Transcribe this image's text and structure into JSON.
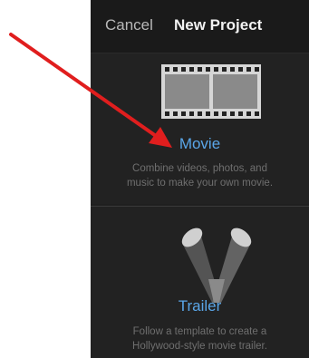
{
  "nav": {
    "cancel_label": "Cancel",
    "title": "New Project"
  },
  "options": [
    {
      "label": "Movie",
      "description_line1": "Combine videos, photos, and",
      "description_line2": "music to make your own movie.",
      "icon": "film-strip-icon"
    },
    {
      "label": "Trailer",
      "description_line1": "Follow a template to create a",
      "description_line2": "Hollywood-style movie trailer.",
      "icon": "spotlights-icon"
    }
  ],
  "colors": {
    "accent": "#5aa6e8",
    "background": "#1f1f1f",
    "annotation_arrow": "#e01e1e"
  }
}
